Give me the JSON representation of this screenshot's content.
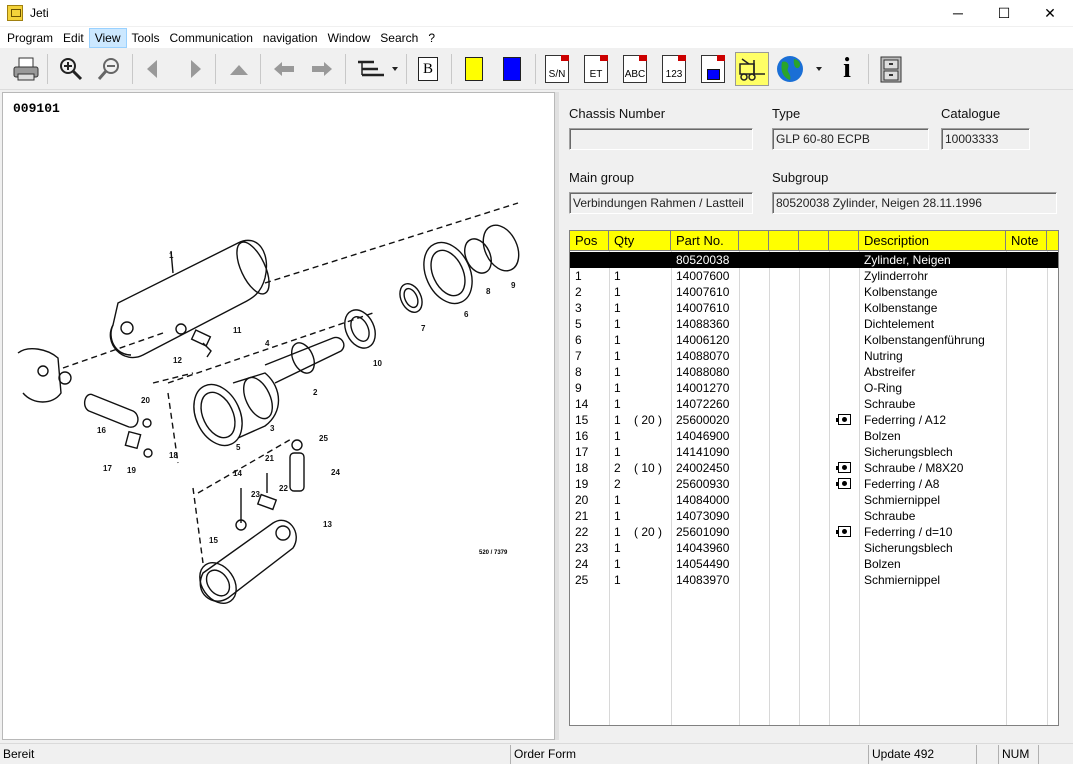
{
  "window": {
    "title": "Jeti",
    "minimize": "─",
    "maximize": "☐",
    "close": "✕"
  },
  "menu": [
    "Program",
    "Edit",
    "View",
    "Tools",
    "Communication",
    "navigation",
    "Window",
    "Search",
    "?"
  ],
  "toolbar": {
    "buttons": [
      "print-icon",
      "zoom-in-icon",
      "zoom-out-icon",
      "back-icon",
      "forward-icon",
      "up-icon",
      "history-back-icon",
      "history-forward-icon",
      "tree-view-icon",
      "bookmark-icon",
      "yellow-marker-icon",
      "blue-marker-icon",
      "serial-number-icon",
      "et-icon",
      "abc-icon",
      "numeric-icon",
      "blue-doc-icon",
      "truck-icon",
      "globe-icon",
      "info-icon",
      "cabinet-icon"
    ],
    "bookmark_label": "B",
    "sn_label": "S/N",
    "et_label": "ET",
    "abc_label": "ABC",
    "num_label": "123",
    "info_label": "i",
    "colors": {
      "yellow": "#ffff00",
      "blue": "#0000ff"
    }
  },
  "drawing": {
    "id": "009101",
    "ref": "520 / 7379"
  },
  "form": {
    "chassis_label": "Chassis Number",
    "chassis_value": "",
    "type_label": "Type",
    "type_value": "GLP 60-80 ECPB",
    "catalogue_label": "Catalogue",
    "catalogue_value": "10003333",
    "main_group_label": "Main group",
    "main_group_value": "Verbindungen Rahmen / Lastteil",
    "subgroup_label": "Subgroup",
    "subgroup_value": "80520038  Zylinder, Neigen 28.11.1996"
  },
  "grid": {
    "headers": {
      "pos": "Pos",
      "qty": "Qty",
      "part": "Part No.",
      "desc": "Description",
      "note": "Note"
    },
    "header_color": "#ffff00",
    "rows": [
      {
        "pos": "",
        "qty": "",
        "qtyx": "",
        "part": "80520038",
        "cam": false,
        "desc": "Zylinder, Neigen",
        "selected": true
      },
      {
        "pos": "1",
        "qty": "1",
        "qtyx": "",
        "part": "14007600",
        "cam": false,
        "desc": "Zylinderrohr"
      },
      {
        "pos": "2",
        "qty": "1",
        "qtyx": "",
        "part": "14007610",
        "cam": false,
        "desc": "Kolbenstange"
      },
      {
        "pos": "3",
        "qty": "1",
        "qtyx": "",
        "part": "14007610",
        "cam": false,
        "desc": "Kolbenstange"
      },
      {
        "pos": "5",
        "qty": "1",
        "qtyx": "",
        "part": "14088360",
        "cam": false,
        "desc": "Dichtelement"
      },
      {
        "pos": "6",
        "qty": "1",
        "qtyx": "",
        "part": "14006120",
        "cam": false,
        "desc": "Kolbenstangenführung"
      },
      {
        "pos": "7",
        "qty": "1",
        "qtyx": "",
        "part": "14088070",
        "cam": false,
        "desc": "Nutring"
      },
      {
        "pos": "8",
        "qty": "1",
        "qtyx": "",
        "part": "14088080",
        "cam": false,
        "desc": "Abstreifer"
      },
      {
        "pos": "9",
        "qty": "1",
        "qtyx": "",
        "part": "14001270",
        "cam": false,
        "desc": "O-Ring"
      },
      {
        "pos": "14",
        "qty": "1",
        "qtyx": "",
        "part": "14072260",
        "cam": false,
        "desc": "Schraube"
      },
      {
        "pos": "15",
        "qty": "1",
        "qtyx": "( 20 )",
        "part": "25600020",
        "cam": true,
        "desc": "Federring / A12"
      },
      {
        "pos": "16",
        "qty": "1",
        "qtyx": "",
        "part": "14046900",
        "cam": false,
        "desc": "Bolzen"
      },
      {
        "pos": "17",
        "qty": "1",
        "qtyx": "",
        "part": "14141090",
        "cam": false,
        "desc": "Sicherungsblech"
      },
      {
        "pos": "18",
        "qty": "2",
        "qtyx": "( 10 )",
        "part": "24002450",
        "cam": true,
        "desc": "Schraube / M8X20"
      },
      {
        "pos": "19",
        "qty": "2",
        "qtyx": "",
        "part": "25600930",
        "cam": true,
        "desc": "Federring / A8"
      },
      {
        "pos": "20",
        "qty": "1",
        "qtyx": "",
        "part": "14084000",
        "cam": false,
        "desc": "Schmiernippel"
      },
      {
        "pos": "21",
        "qty": "1",
        "qtyx": "",
        "part": "14073090",
        "cam": false,
        "desc": "Schraube"
      },
      {
        "pos": "22",
        "qty": "1",
        "qtyx": "( 20 )",
        "part": "25601090",
        "cam": true,
        "desc": "Federring / d=10"
      },
      {
        "pos": "23",
        "qty": "1",
        "qtyx": "",
        "part": "14043960",
        "cam": false,
        "desc": "Sicherungsblech"
      },
      {
        "pos": "24",
        "qty": "1",
        "qtyx": "",
        "part": "14054490",
        "cam": false,
        "desc": "Bolzen"
      },
      {
        "pos": "25",
        "qty": "1",
        "qtyx": "",
        "part": "14083970",
        "cam": false,
        "desc": "Schmiernippel"
      }
    ]
  },
  "status": {
    "left": "Bereit",
    "order": "Order Form",
    "update": "Update 492",
    "empty": "",
    "num": "NUM"
  }
}
